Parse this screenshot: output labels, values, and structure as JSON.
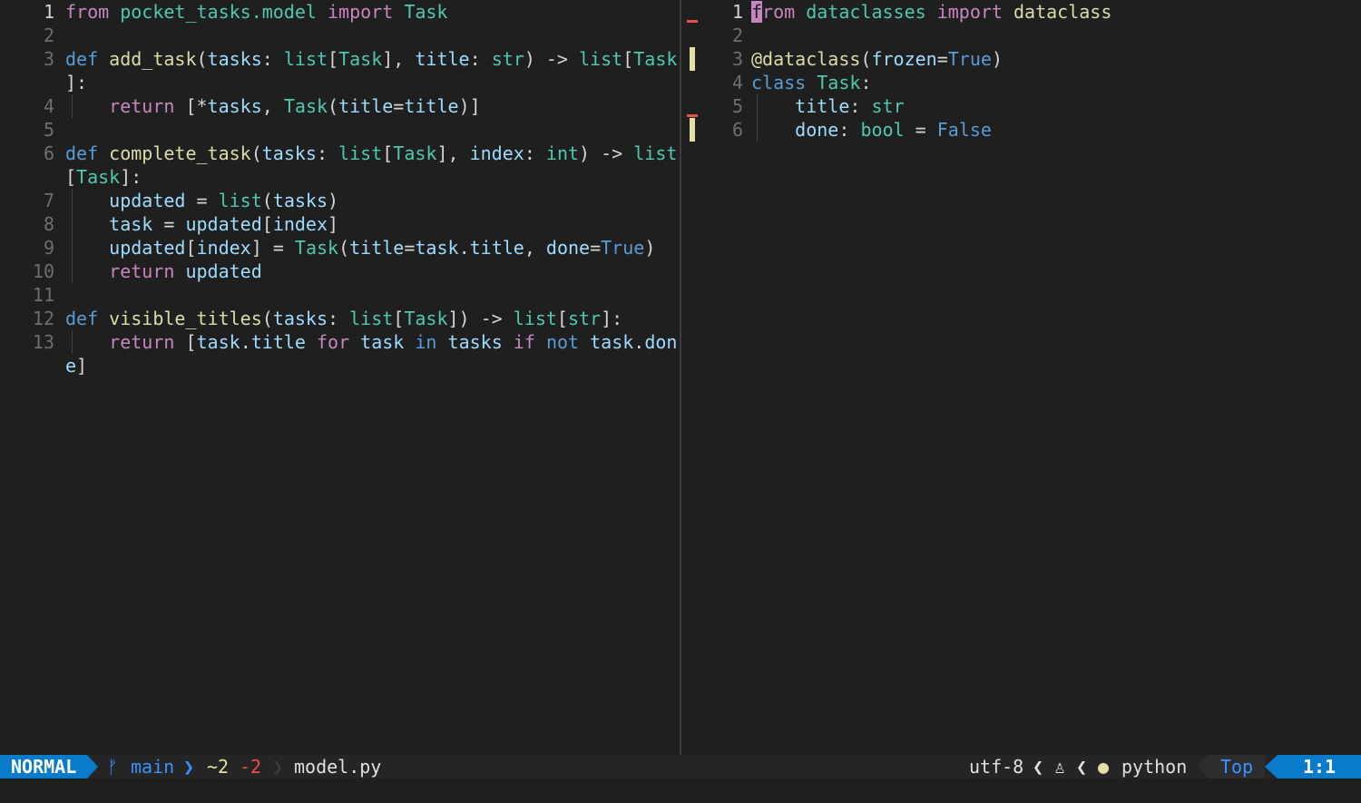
{
  "left": {
    "filename": "model.py",
    "lines": [
      {
        "n": "1",
        "tokens": [
          [
            "kw",
            "from"
          ],
          [
            "punc",
            " "
          ],
          [
            "ty",
            "pocket_tasks.model"
          ],
          [
            "punc",
            " "
          ],
          [
            "kw",
            "import"
          ],
          [
            "punc",
            " "
          ],
          [
            "ty",
            "Task"
          ]
        ]
      },
      {
        "n": "2",
        "tokens": []
      },
      {
        "n": "3",
        "tokens": [
          [
            "def",
            "def"
          ],
          [
            "punc",
            " "
          ],
          [
            "fn",
            "add_task"
          ],
          [
            "punc",
            "("
          ],
          [
            "var",
            "tasks"
          ],
          [
            "punc",
            ": "
          ],
          [
            "ty",
            "list"
          ],
          [
            "punc",
            "["
          ],
          [
            "ty",
            "Task"
          ],
          [
            "punc",
            "], "
          ],
          [
            "var",
            "title"
          ],
          [
            "punc",
            ": "
          ],
          [
            "ty",
            "str"
          ],
          [
            "punc",
            ") -> "
          ],
          [
            "ty",
            "list"
          ],
          [
            "punc",
            "["
          ],
          [
            "ty",
            "Task"
          ]
        ]
      },
      {
        "n": "",
        "tokens": [
          [
            "punc",
            "]:"
          ]
        ]
      },
      {
        "n": "4",
        "guide": true,
        "tokens": [
          [
            "punc",
            "    "
          ],
          [
            "kw",
            "return"
          ],
          [
            "punc",
            " [*"
          ],
          [
            "var",
            "tasks"
          ],
          [
            "punc",
            ", "
          ],
          [
            "ty",
            "Task"
          ],
          [
            "punc",
            "("
          ],
          [
            "var",
            "title"
          ],
          [
            "punc",
            "="
          ],
          [
            "var",
            "title"
          ],
          [
            "punc",
            ")]"
          ]
        ]
      },
      {
        "n": "5",
        "tokens": []
      },
      {
        "n": "6",
        "tokens": [
          [
            "def",
            "def"
          ],
          [
            "punc",
            " "
          ],
          [
            "fn",
            "complete_task"
          ],
          [
            "punc",
            "("
          ],
          [
            "var",
            "tasks"
          ],
          [
            "punc",
            ": "
          ],
          [
            "ty",
            "list"
          ],
          [
            "punc",
            "["
          ],
          [
            "ty",
            "Task"
          ],
          [
            "punc",
            "], "
          ],
          [
            "var",
            "index"
          ],
          [
            "punc",
            ": "
          ],
          [
            "ty",
            "int"
          ],
          [
            "punc",
            ") -> "
          ],
          [
            "ty",
            "list"
          ]
        ]
      },
      {
        "n": "",
        "tokens": [
          [
            "punc",
            "["
          ],
          [
            "ty",
            "Task"
          ],
          [
            "punc",
            "]:"
          ]
        ]
      },
      {
        "n": "7",
        "guide": true,
        "tokens": [
          [
            "punc",
            "    "
          ],
          [
            "var",
            "updated"
          ],
          [
            "punc",
            " = "
          ],
          [
            "ty",
            "list"
          ],
          [
            "punc",
            "("
          ],
          [
            "var",
            "tasks"
          ],
          [
            "punc",
            ")"
          ]
        ]
      },
      {
        "n": "8",
        "guide": true,
        "tokens": [
          [
            "punc",
            "    "
          ],
          [
            "var",
            "task"
          ],
          [
            "punc",
            " = "
          ],
          [
            "var",
            "updated"
          ],
          [
            "punc",
            "["
          ],
          [
            "var",
            "index"
          ],
          [
            "punc",
            "]"
          ]
        ]
      },
      {
        "n": "9",
        "guide": true,
        "tokens": [
          [
            "punc",
            "    "
          ],
          [
            "var",
            "updated"
          ],
          [
            "punc",
            "["
          ],
          [
            "var",
            "index"
          ],
          [
            "punc",
            "] = "
          ],
          [
            "ty",
            "Task"
          ],
          [
            "punc",
            "("
          ],
          [
            "var",
            "title"
          ],
          [
            "punc",
            "="
          ],
          [
            "var",
            "task"
          ],
          [
            "punc",
            "."
          ],
          [
            "var",
            "title"
          ],
          [
            "punc",
            ", "
          ],
          [
            "var",
            "done"
          ],
          [
            "punc",
            "="
          ],
          [
            "const",
            "True"
          ],
          [
            "punc",
            ")"
          ]
        ]
      },
      {
        "n": "10",
        "guide": true,
        "tokens": [
          [
            "punc",
            "    "
          ],
          [
            "kw",
            "return"
          ],
          [
            "punc",
            " "
          ],
          [
            "var",
            "updated"
          ]
        ]
      },
      {
        "n": "11",
        "tokens": []
      },
      {
        "n": "12",
        "tokens": [
          [
            "def",
            "def"
          ],
          [
            "punc",
            " "
          ],
          [
            "fn",
            "visible_titles"
          ],
          [
            "punc",
            "("
          ],
          [
            "var",
            "tasks"
          ],
          [
            "punc",
            ": "
          ],
          [
            "ty",
            "list"
          ],
          [
            "punc",
            "["
          ],
          [
            "ty",
            "Task"
          ],
          [
            "punc",
            "]) -> "
          ],
          [
            "ty",
            "list"
          ],
          [
            "punc",
            "["
          ],
          [
            "ty",
            "str"
          ],
          [
            "punc",
            "]:"
          ]
        ]
      },
      {
        "n": "13",
        "guide": true,
        "tokens": [
          [
            "punc",
            "    "
          ],
          [
            "kw",
            "return"
          ],
          [
            "punc",
            " ["
          ],
          [
            "var",
            "task"
          ],
          [
            "punc",
            "."
          ],
          [
            "var",
            "title"
          ],
          [
            "punc",
            " "
          ],
          [
            "kw",
            "for"
          ],
          [
            "punc",
            " "
          ],
          [
            "var",
            "task"
          ],
          [
            "punc",
            " "
          ],
          [
            "def",
            "in"
          ],
          [
            "punc",
            " "
          ],
          [
            "var",
            "tasks"
          ],
          [
            "punc",
            " "
          ],
          [
            "kw",
            "if"
          ],
          [
            "punc",
            " "
          ],
          [
            "def",
            "not"
          ],
          [
            "punc",
            " "
          ],
          [
            "var",
            "task"
          ],
          [
            "punc",
            "."
          ],
          [
            "var",
            "don"
          ]
        ]
      },
      {
        "n": "",
        "tokens": [
          [
            "var",
            "e"
          ],
          [
            "punc",
            "]"
          ]
        ]
      }
    ]
  },
  "right": {
    "lines": [
      {
        "n": "1",
        "current": true,
        "tokens": [
          [
            "cursor",
            "f"
          ],
          [
            "kw",
            "rom"
          ],
          [
            "punc",
            " "
          ],
          [
            "ty",
            "dataclasses"
          ],
          [
            "punc",
            " "
          ],
          [
            "kw",
            "import"
          ],
          [
            "punc",
            " "
          ],
          [
            "fn",
            "dataclass"
          ]
        ]
      },
      {
        "n": "2",
        "tokens": []
      },
      {
        "n": "3",
        "tokens": [
          [
            "fn",
            "@dataclass"
          ],
          [
            "punc",
            "("
          ],
          [
            "var",
            "frozen"
          ],
          [
            "punc",
            "="
          ],
          [
            "const",
            "True"
          ],
          [
            "punc",
            ")"
          ]
        ]
      },
      {
        "n": "4",
        "tokens": [
          [
            "def",
            "class"
          ],
          [
            "punc",
            " "
          ],
          [
            "ty",
            "Task"
          ],
          [
            "punc",
            ":"
          ]
        ]
      },
      {
        "n": "5",
        "guide": true,
        "tokens": [
          [
            "punc",
            "    "
          ],
          [
            "var",
            "title"
          ],
          [
            "punc",
            ": "
          ],
          [
            "ty",
            "str"
          ]
        ]
      },
      {
        "n": "6",
        "guide": true,
        "tokens": [
          [
            "punc",
            "    "
          ],
          [
            "var",
            "done"
          ],
          [
            "punc",
            ": "
          ],
          [
            "ty",
            "bool"
          ],
          [
            "punc",
            " = "
          ],
          [
            "const",
            "False"
          ]
        ]
      }
    ]
  },
  "statusline": {
    "mode": "NORMAL",
    "branch_icon": "git-branch-icon",
    "branch": "main",
    "changed": "~2",
    "deleted": "-2",
    "filename": "model.py",
    "encoding": "utf-8",
    "os_icon": "linux-icon",
    "ft_icon": "python-icon",
    "filetype": "python",
    "scroll": "Top",
    "position": "1:1"
  },
  "colors": {
    "accent": "#0a7aca",
    "added": "#e5dfa5",
    "deleted": "#f14c4c"
  }
}
